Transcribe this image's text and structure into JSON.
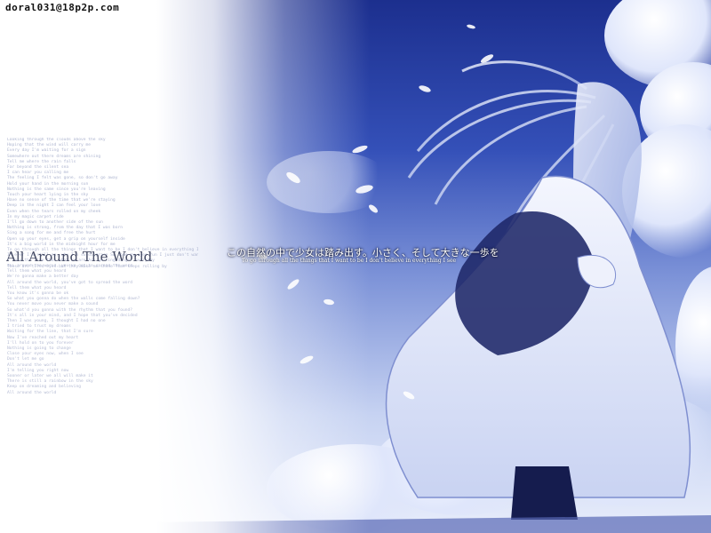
{
  "watermark": {
    "email": "doral031@18p2p.com"
  },
  "song": {
    "title": "All Around The World"
  },
  "caption": {
    "japanese": "この自然の中で少女は踏み出す。小さく、そして大きな一歩を",
    "english": "To go through all the things that I want to be I don't believe in everything I see"
  },
  "lyrics_top": [
    "Looking through the clouds above the sky",
    "Hoping that the wind will carry me",
    "Every day I'm waiting for a sign",
    "Somewhere out there dreams are shining",
    "Tell me where the rain falls",
    "Far beyond the silent sea",
    "I can hear you calling me",
    "The feeling I felt was gone, so don't go away",
    "Hold your hand in the morning sun",
    "Nothing is the same since you're leaving",
    "Touch your heart lying in the sky",
    "Have no sense of the time that we're staying",
    "Deep in the night I can feel your love",
    "Even when the tears rolled on my cheek",
    "In my magic carpet ride",
    "I'll go down to another side of the sun",
    "Nothing is strong, from the day that I was born",
    "Sing a song for me and free the hurt",
    "Open up your eyes, get a grip on yourself inside",
    "It's a big world in the midnight hour for me",
    "To go through all the things that I want to be  I don't believe in everything I see",
    "If ever I'm still on, why I'm so disgrace  So come my eyes run I just don't want to sta",
    "I take the time that what we are  Are getting danger everyday",
    "These are tired eyes but they make me shine  Time keeps rolling by"
  ],
  "lyrics_bottom": [
    "All around the world, you've got to spread the word",
    "Tell them what you heard",
    "We're gonna make a better day",
    "All around the world, you've got to spread the word",
    "Tell them what you heard",
    "You know it's gonna be ok",
    "So what you gonna do when the walls come falling down?",
    "You never move you never make a sound",
    "So what'd you gonna with the rhythm that you found?",
    "It's all in your mind, and I hope that you've decided",
    "Then I was young, I thought I had no one",
    "I tried to trust my dreams",
    "Waiting for the line, that I'm sure",
    "Now I've reached out my heart",
    "I'll hold on to you forever",
    "Nothing is going to change",
    "Close your eyes now, when I see",
    "Don't let me go",
    "All around the world",
    "I'm telling you right now",
    "Sooner or later we all will make it",
    "There is still a rainbow in the sky",
    "Keep on dreaming and believing",
    "All around the world"
  ]
}
